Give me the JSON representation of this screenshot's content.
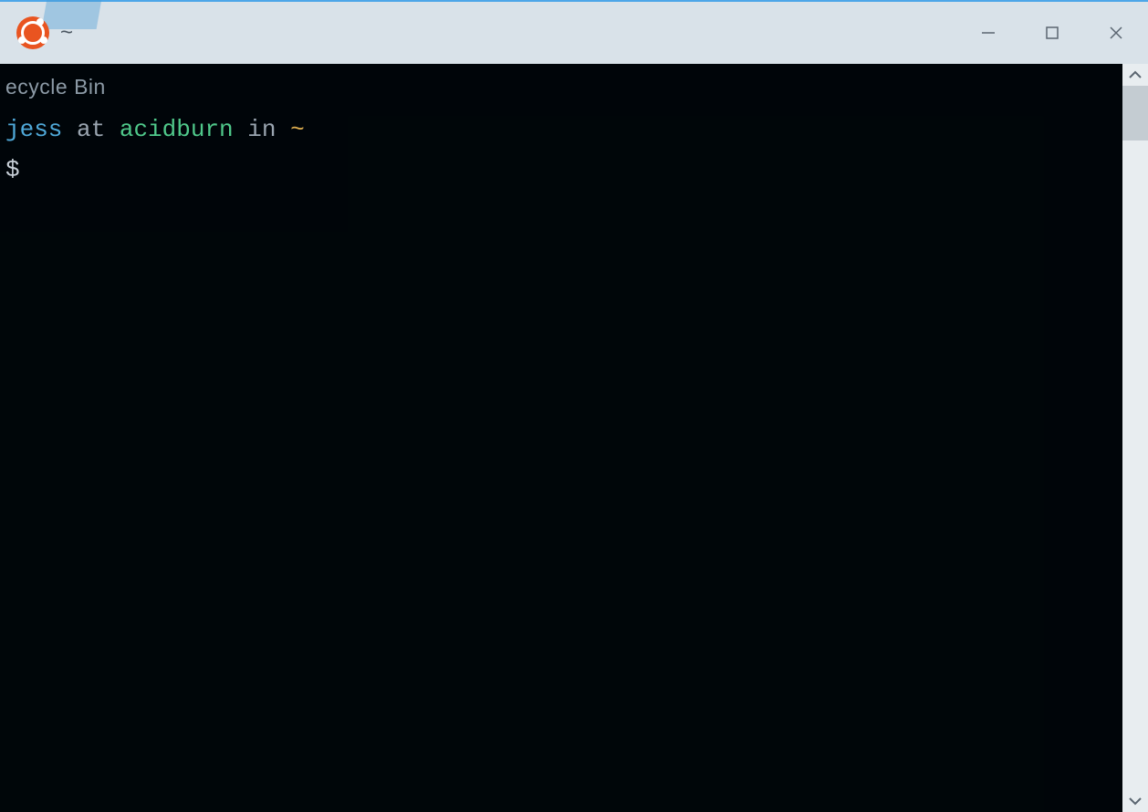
{
  "window": {
    "title": "~",
    "app_icon": "ubuntu-logo"
  },
  "desktop": {
    "visible_label": "ecycle Bin"
  },
  "prompt": {
    "user": "jess",
    "at": " at ",
    "host": "acidburn",
    "in": " in ",
    "path": "~",
    "symbol": "$"
  },
  "colors": {
    "user": "#4fa8d8",
    "host": "#4fc88a",
    "path": "#e0b050",
    "titlebar_bg": "#d9e2e9",
    "accent_border": "#4da6e8",
    "terminal_bg": "#010508"
  }
}
